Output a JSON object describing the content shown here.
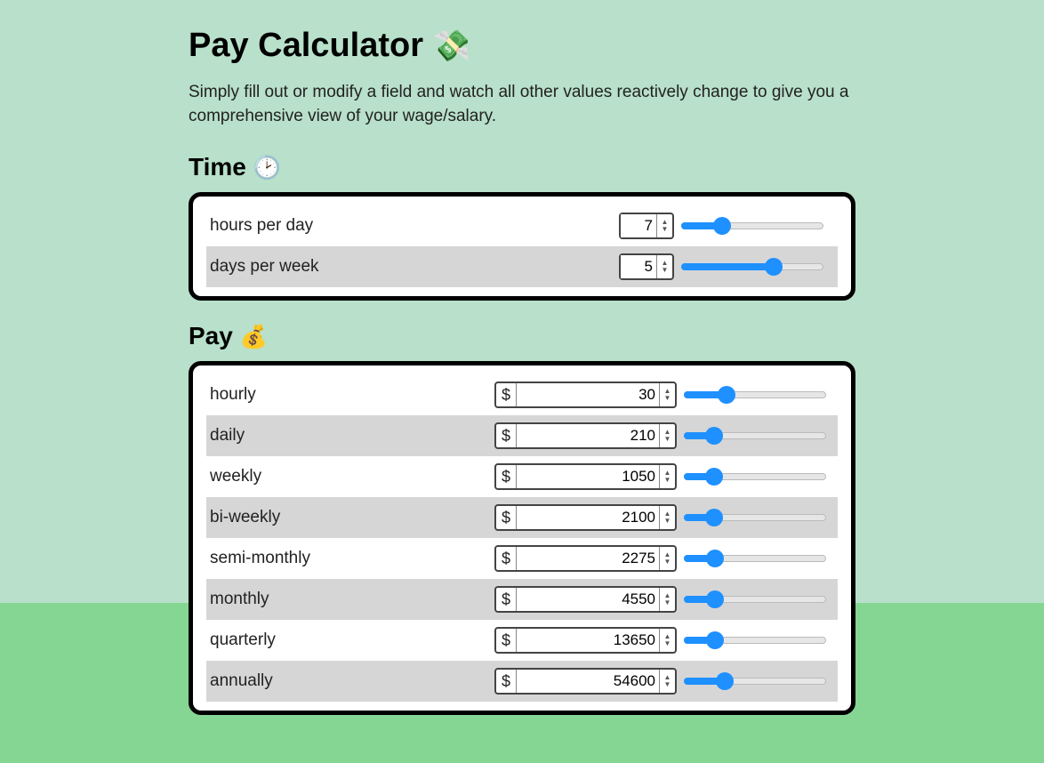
{
  "title": "Pay Calculator",
  "title_emoji": "💸",
  "subtitle": "Simply fill out or modify a field and watch all other values reactively change to give you a comprehensive view of your wage/salary.",
  "time": {
    "heading": "Time",
    "heading_emoji": "🕑",
    "rows": [
      {
        "label": "hours per day",
        "value": "7",
        "slider_pct": 29
      },
      {
        "label": "days per week",
        "value": "5",
        "slider_pct": 65
      }
    ]
  },
  "pay": {
    "heading": "Pay",
    "heading_emoji": "💰",
    "currency": "$",
    "rows": [
      {
        "label": "hourly",
        "value": "30",
        "slider_pct": 30
      },
      {
        "label": "daily",
        "value": "210",
        "slider_pct": 21
      },
      {
        "label": "weekly",
        "value": "1050",
        "slider_pct": 21
      },
      {
        "label": "bi-weekly",
        "value": "2100",
        "slider_pct": 21
      },
      {
        "label": "semi-monthly",
        "value": "2275",
        "slider_pct": 22
      },
      {
        "label": "monthly",
        "value": "4550",
        "slider_pct": 22
      },
      {
        "label": "quarterly",
        "value": "13650",
        "slider_pct": 22
      },
      {
        "label": "annually",
        "value": "54600",
        "slider_pct": 29
      }
    ]
  }
}
